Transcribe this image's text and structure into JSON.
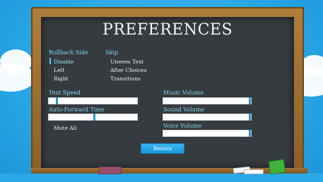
{
  "screen": {
    "title": "PREFERENCES",
    "rollback": {
      "label": "Rollback Side",
      "options": [
        "Disable",
        "Left",
        "Right"
      ],
      "selected": "Disable"
    },
    "skip": {
      "label": "Skip",
      "options": [
        "Unseen Text",
        "After Choices",
        "Transitions"
      ]
    },
    "text_speed": {
      "label": "Text Speed",
      "value": 0.08
    },
    "auto_forward": {
      "label": "Auto-Forward Time",
      "value": 0.52
    },
    "mute_all": {
      "label": "Mute All"
    },
    "music_volume": {
      "label": "Music Volume",
      "value": 1.0
    },
    "sound_volume": {
      "label": "Sound Volume",
      "value": 1.0
    },
    "voice_volume": {
      "label": "Voice Volume",
      "value": 1.0
    },
    "return_button": {
      "label": "Return"
    }
  },
  "colors": {
    "board": "#363b3f",
    "frame": "#a0702f",
    "heading_text": "#7fd6ef",
    "accent": "#2b95d0"
  }
}
